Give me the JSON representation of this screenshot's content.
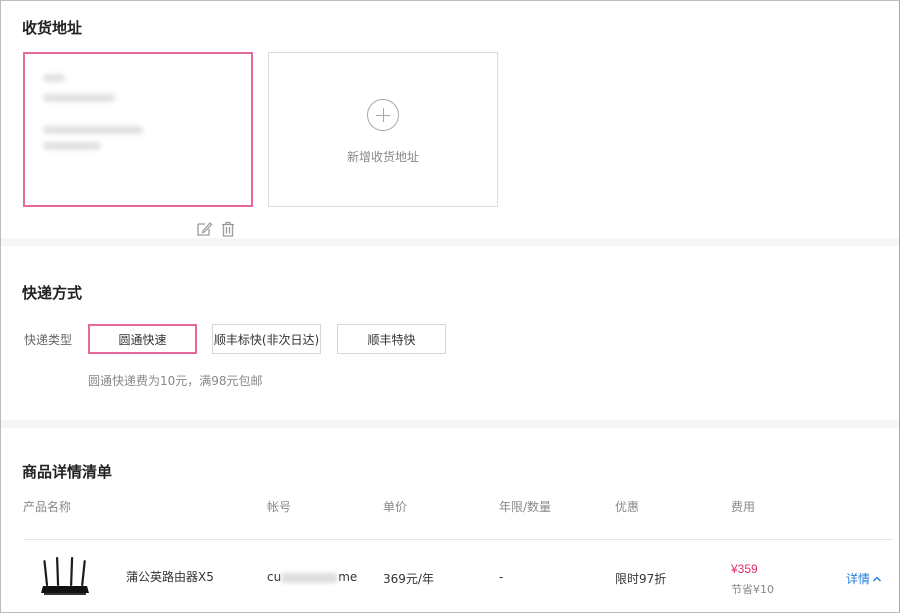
{
  "address": {
    "title": "收货地址",
    "card": {
      "edit_icon": "edit-icon",
      "delete_icon": "trash-icon"
    },
    "add_label": "新增收货地址",
    "add_icon": "plus-circle-icon"
  },
  "shipping": {
    "title": "快递方式",
    "type_label": "快递类型",
    "options": [
      "圆通快速",
      "顺丰标快(非次日达)",
      "顺丰特快"
    ],
    "selected": "圆通快速",
    "note": "圆通快递费为10元，满98元包邮"
  },
  "products": {
    "title": "商品详情清单",
    "columns": [
      "产品名称",
      "帐号",
      "单价",
      "年限/数量",
      "优惠",
      "费用"
    ],
    "rows": [
      {
        "name": "蒲公英路由器X5",
        "account_prefix": "cu",
        "account_suffix": "me",
        "unit_price": "369元/年",
        "period_qty": "-",
        "discount": "限时97折",
        "price": "¥359",
        "saving": "节省¥10",
        "details_label": "详情"
      }
    ]
  },
  "colors": {
    "accent": "#e56a9b",
    "price": "#e02e63",
    "link": "#1f7de0"
  }
}
